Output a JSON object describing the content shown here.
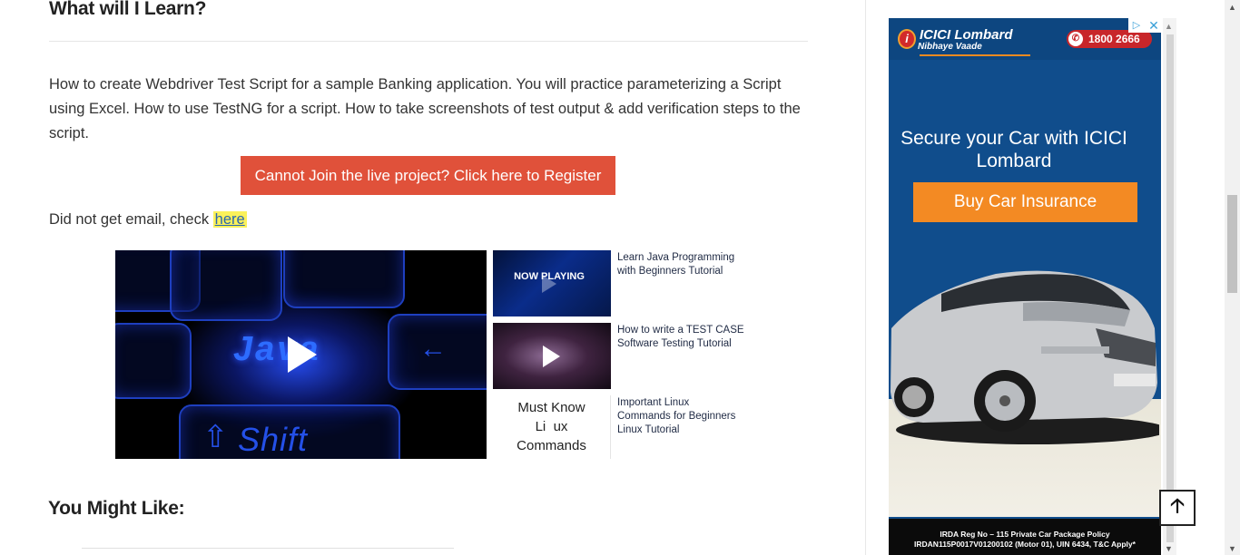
{
  "article": {
    "heading_learn": "What will I Learn?",
    "paragraph": "How to create Webdriver Test Script for a sample Banking application. You will practice parameterizing a Script using Excel. How to use TestNG for a script. How to take screenshots of test output & add verification steps to the script.",
    "register_button": "Cannot Join the live project? Click here to Register",
    "email_prefix": "Did not get email, check ",
    "email_link": "here",
    "heading_like": "You Might Like:"
  },
  "video": {
    "main_keyword": "Java",
    "main_shift": "Shift",
    "playlist": [
      {
        "title": "Learn Java Programming with Beginners Tutorial",
        "badge": "NOW PLAYING"
      },
      {
        "title": "How to write a TEST CASE Software Testing Tutorial"
      },
      {
        "title": "Important Linux Commands for Beginners Linux Tutorial",
        "thumb_text": "Must Know Li  ux Commands"
      }
    ]
  },
  "ad": {
    "brand": "ICICI Lombard",
    "tagline": "Nibhaye Vaade",
    "phone": "1800 2666",
    "headline": "Secure your Car with ICICI Lombard",
    "cta": "Buy Car Insurance",
    "footer_line1": "IRDA Reg No – 115 Private Car Package Policy",
    "footer_line2": "IRDAN115P0017V01200102 (Motor 01), UIN 6434, T&C Apply*",
    "colors": {
      "background": "#104d8c",
      "cta": "#f38a23",
      "phone_badge": "#c8262a"
    }
  },
  "colors": {
    "register_button": "#e0513a",
    "link_highlight": "#fbf15a",
    "link_text": "#2a66b0"
  },
  "icons": {
    "play": "play-icon",
    "back_to_top": "arrow-up-icon",
    "ad_choices": "adchoices-icon",
    "ad_close": "close-icon",
    "phone": "phone-icon"
  }
}
